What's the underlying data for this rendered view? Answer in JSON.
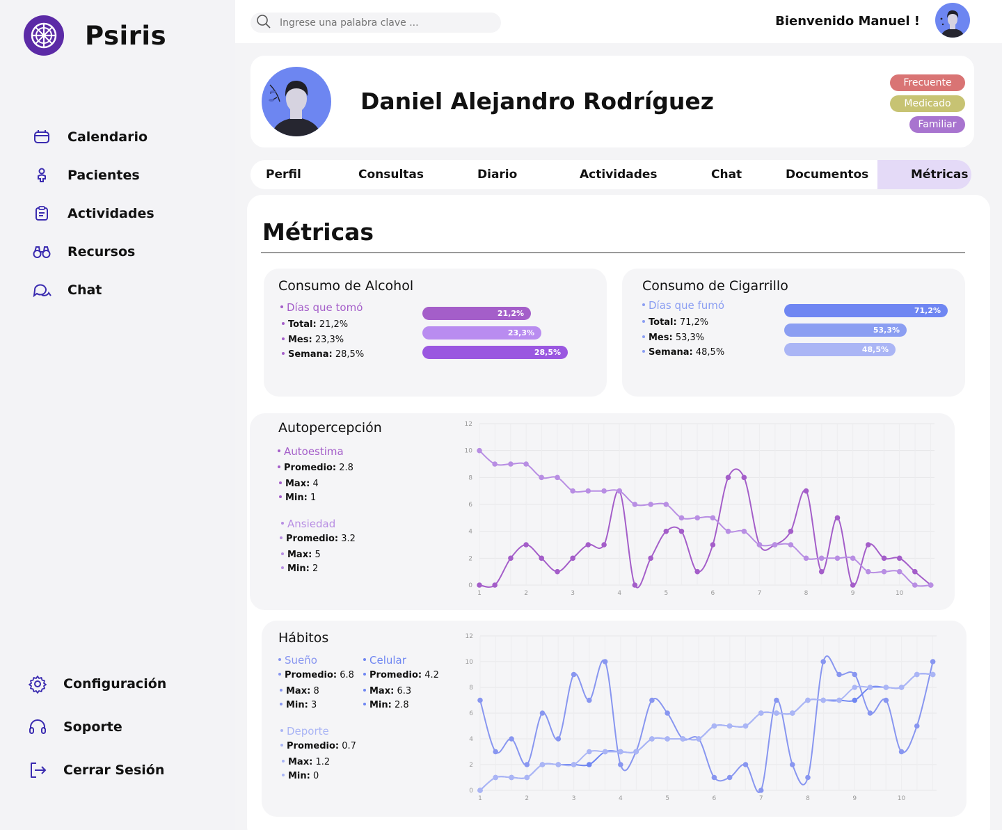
{
  "app": {
    "name": "Psiris"
  },
  "sidebar": {
    "items": [
      {
        "label": "Calendario",
        "icon": "calendar-icon"
      },
      {
        "label": "Pacientes",
        "icon": "patient-icon"
      },
      {
        "label": "Actividades",
        "icon": "clipboard-icon"
      },
      {
        "label": "Recursos",
        "icon": "binoculars-icon"
      },
      {
        "label": "Chat",
        "icon": "chat-icon"
      }
    ],
    "bottom": [
      {
        "label": "Configuración",
        "icon": "gear-icon"
      },
      {
        "label": "Soporte",
        "icon": "headset-icon"
      },
      {
        "label": "Cerrar Sesión",
        "icon": "logout-icon"
      }
    ]
  },
  "topbar": {
    "search_placeholder": "Ingrese una palabra clave ...",
    "welcome": "Bienvenido Manuel !"
  },
  "patient": {
    "name": "Daniel Alejandro Rodríguez",
    "tags": [
      {
        "label": "Frecuente",
        "color": "#d97474"
      },
      {
        "label": "Medicado",
        "color": "#c7c373"
      },
      {
        "label": "Familiar",
        "color": "#a874cf"
      }
    ]
  },
  "tabs": [
    "Perfil",
    "Consultas",
    "Diario",
    "Actividades",
    "Chat",
    "Documentos",
    "Métricas"
  ],
  "active_tab": "Métricas",
  "metrics": {
    "title": "Métricas",
    "alcohol": {
      "title": "Consumo de Alcohol",
      "subtitle": "Días que tomó",
      "stats": [
        {
          "label": "Total:",
          "value": "21,2%"
        },
        {
          "label": "Mes:",
          "value": "23,3%"
        },
        {
          "label": "Semana:",
          "value": "28,5%"
        }
      ],
      "bars": [
        {
          "label": "21,2%",
          "value": 21.2,
          "color": "#a45ec9"
        },
        {
          "label": "23,3%",
          "value": 23.3,
          "color": "#b98cf0"
        },
        {
          "label": "28,5%",
          "value": 28.5,
          "color": "#9a57e0"
        }
      ]
    },
    "cigarrillo": {
      "title": "Consumo de Cigarrillo",
      "subtitle": "Días que fumó",
      "stats": [
        {
          "label": "Total:",
          "value": "71,2%"
        },
        {
          "label": "Mes:",
          "value": "53,3%"
        },
        {
          "label": "Semana:",
          "value": "48,5%"
        }
      ],
      "bars": [
        {
          "label": "71,2%",
          "value": 71.2,
          "color": "#6f86f2"
        },
        {
          "label": "53,3%",
          "value": 53.3,
          "color": "#8b9ef2"
        },
        {
          "label": "48,5%",
          "value": 48.5,
          "color": "#aab5f5"
        }
      ]
    },
    "autopercepcion": {
      "title": "Autopercepción",
      "groups": [
        {
          "name": "Autoestima",
          "color": "#a45ec9",
          "stats": [
            {
              "label": "Promedio:",
              "value": "2.8"
            },
            {
              "label": "Max:",
              "value": "4"
            },
            {
              "label": "Min:",
              "value": "1"
            }
          ]
        },
        {
          "name": "Ansiedad",
          "color": "#b88ee3",
          "stats": [
            {
              "label": "Promedio:",
              "value": "3.2"
            },
            {
              "label": "Max:",
              "value": "5"
            },
            {
              "label": "Min:",
              "value": "2"
            }
          ]
        }
      ]
    },
    "habitos": {
      "title": "Hábitos",
      "groups": [
        {
          "name": "Sueño",
          "color": "#8896f0",
          "stats": [
            {
              "label": "Promedio:",
              "value": "6.8"
            },
            {
              "label": "Max:",
              "value": "8"
            },
            {
              "label": "Min:",
              "value": "3"
            }
          ]
        },
        {
          "name": "Celular",
          "color": "#6f86f2",
          "stats": [
            {
              "label": "Promedio:",
              "value": "4.2"
            },
            {
              "label": "Max:",
              "value": "6.3"
            },
            {
              "label": "Min:",
              "value": "2.8"
            }
          ]
        },
        {
          "name": "Deporte",
          "color": "#aab5f5",
          "stats": [
            {
              "label": "Promedio:",
              "value": "0.7"
            },
            {
              "label": "Max:",
              "value": "1.2"
            },
            {
              "label": "Min:",
              "value": "0"
            }
          ]
        }
      ]
    }
  },
  "chart_data": [
    {
      "type": "bar",
      "categories": [
        "Total",
        "Mes",
        "Semana"
      ],
      "values": [
        21.2,
        23.3,
        28.5
      ]
    },
    {
      "type": "bar",
      "categories": [
        "Total",
        "Mes",
        "Semana"
      ],
      "values": [
        71.2,
        53.3,
        48.5
      ]
    },
    {
      "type": "line",
      "xticks": [
        1,
        2,
        3,
        4,
        5,
        6,
        7,
        8,
        9,
        10
      ],
      "ylim": [
        0,
        12
      ],
      "yticks": [
        0,
        2,
        4,
        6,
        8,
        10,
        12
      ],
      "grid": true,
      "series": [
        {
          "name": "Autoestima",
          "color": "#a45ec9",
          "x": [
            1,
            1.33,
            1.67,
            2,
            2.33,
            2.67,
            3,
            3.33,
            3.67,
            4,
            4.33,
            4.67,
            5,
            5.33,
            5.67,
            6,
            6.33,
            6.67,
            7,
            7.33,
            7.67,
            8,
            8.33,
            8.67,
            9,
            9.33,
            9.67,
            10,
            10.33,
            10.67
          ],
          "y": [
            0,
            0,
            2,
            3,
            2,
            1,
            2,
            3,
            3,
            7,
            0,
            2,
            4,
            4,
            1,
            3,
            8,
            8,
            3,
            3,
            4,
            7,
            1,
            5,
            0,
            3,
            2,
            2,
            1,
            0
          ]
        },
        {
          "name": "Ansiedad",
          "color": "#b88ee3",
          "x": [
            1,
            1.33,
            1.67,
            2,
            2.33,
            2.67,
            3,
            3.33,
            3.67,
            4,
            4.33,
            4.67,
            5,
            5.33,
            5.67,
            6,
            6.33,
            6.67,
            7,
            7.33,
            7.67,
            8,
            8.33,
            8.67,
            9,
            9.33,
            9.67,
            10,
            10.33,
            10.67
          ],
          "y": [
            10,
            9,
            9,
            9,
            8,
            8,
            7,
            7,
            7,
            7,
            6,
            6,
            6,
            5,
            5,
            5,
            4,
            4,
            3,
            3,
            3,
            2,
            2,
            2,
            2,
            1,
            1,
            1,
            0,
            0
          ]
        }
      ]
    },
    {
      "type": "line",
      "xticks": [
        1,
        2,
        3,
        4,
        5,
        6,
        7,
        8,
        9,
        10
      ],
      "ylim": [
        0,
        12
      ],
      "yticks": [
        0,
        2,
        4,
        6,
        8,
        10,
        12
      ],
      "grid": true,
      "series": [
        {
          "name": "Sueño",
          "color": "#8896f0",
          "x": [
            1,
            1.33,
            1.67,
            2,
            2.33,
            2.67,
            3,
            3.33,
            3.67,
            4,
            4.33,
            4.67,
            5,
            5.33,
            5.67,
            6,
            6.33,
            6.67,
            7,
            7.33,
            7.67,
            8,
            8.33,
            8.67,
            9,
            9.33,
            9.67,
            10,
            10.33,
            10.67
          ],
          "y": [
            7,
            3,
            4,
            2,
            6,
            4,
            9,
            7,
            10,
            2,
            3,
            7,
            6,
            4,
            4,
            1,
            1,
            2,
            0,
            7,
            2,
            1,
            10,
            9,
            9,
            6,
            7,
            3,
            5,
            10
          ]
        },
        {
          "name": "Celular",
          "color": "#6f86f2",
          "x": [
            1,
            1.33,
            1.67,
            2,
            2.33,
            2.67,
            3,
            3.33,
            3.67,
            4,
            4.33,
            4.67,
            5,
            5.33,
            5.67,
            6,
            6.33,
            6.67,
            7,
            7.33,
            7.67,
            8,
            8.33,
            8.67,
            9,
            9.33,
            9.67,
            10,
            10.33,
            10.67
          ],
          "y": [
            0,
            1,
            1,
            1,
            2,
            2,
            2,
            2,
            3,
            3,
            3,
            4,
            4,
            4,
            4,
            5,
            5,
            5,
            6,
            6,
            6,
            7,
            7,
            7,
            7,
            8,
            8,
            8,
            9,
            9
          ]
        },
        {
          "name": "Deporte",
          "color": "#aab5f5",
          "x": [
            1,
            1.33,
            1.67,
            2,
            2.33,
            2.67,
            3,
            3.33,
            3.67,
            4,
            4.33,
            4.67,
            5,
            5.33,
            5.67,
            6,
            6.33,
            6.67,
            7,
            7.33,
            7.67,
            8,
            8.33,
            8.67,
            9,
            9.33,
            9.67,
            10,
            10.33,
            10.67
          ],
          "y": [
            0,
            1,
            1,
            1,
            2,
            2,
            2,
            3,
            3,
            3,
            3,
            4,
            4,
            4,
            4,
            5,
            5,
            5,
            6,
            6,
            6,
            7,
            7,
            7,
            8,
            8,
            8,
            8,
            9,
            9
          ]
        }
      ]
    }
  ]
}
